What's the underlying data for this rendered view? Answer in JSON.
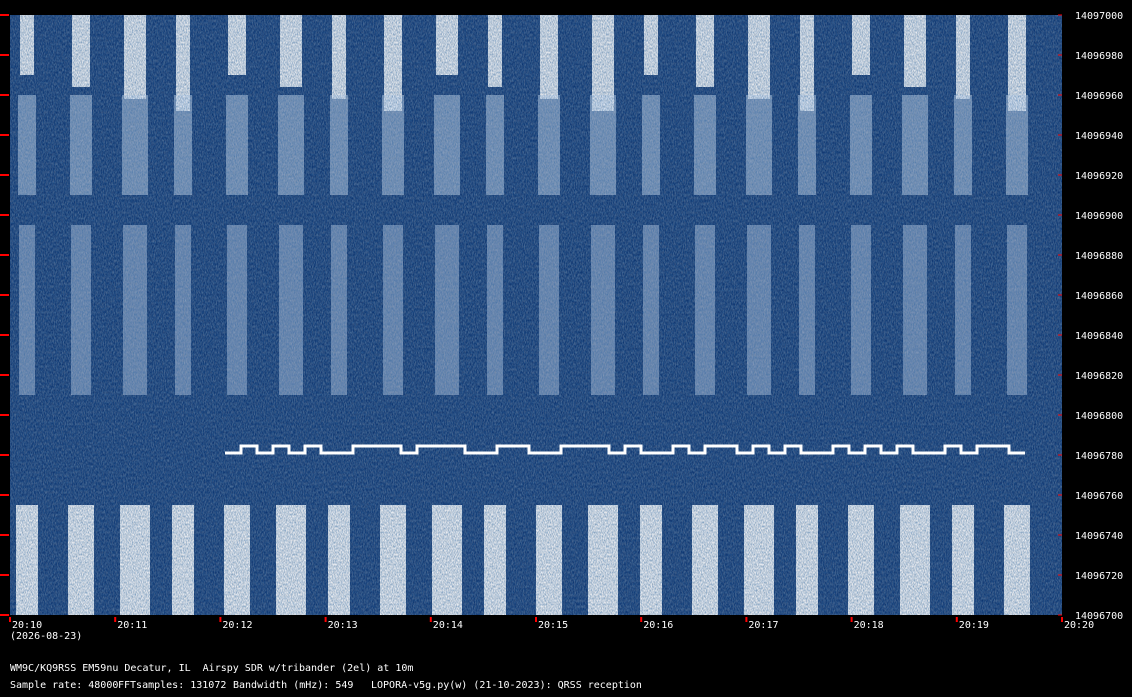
{
  "frequency_axis": {
    "min": 14096700,
    "max": 14097000,
    "step": 20,
    "labels": [
      "14097000",
      "14096980",
      "14096960",
      "14096940",
      "14096920",
      "14096900",
      "14096880",
      "14096860",
      "14096840",
      "14096820",
      "14096800",
      "14096780",
      "14096760",
      "14096740",
      "14096720",
      "14096700"
    ]
  },
  "time_axis": {
    "labels": [
      "20:10",
      "20:11",
      "20:12",
      "20:13",
      "20:14",
      "20:15",
      "20:16",
      "20:17",
      "20:18",
      "20:19",
      "20:20"
    ],
    "date": "(2026-08-23)"
  },
  "info": {
    "station_line": "WM9C/KQ9RSS EM59nu Decatur, IL  Airspy SDR w/tribander (2el) at 10m",
    "sample_rate": "Sample rate: 48000",
    "fft_samples": "FFTsamples: 131072",
    "bandwidth": "Bandwidth (mHz): 549",
    "software": "LOPORA-v5g.py(w) (21-10-2023): QRSS reception"
  },
  "colors": {
    "background": "#000000",
    "waterfall_dark": "#0a2a5c",
    "waterfall_mid": "#1f5a9e",
    "waterfall_bright": "#ffffff",
    "tick_marker": "#ff0000",
    "text": "#ffffff"
  }
}
